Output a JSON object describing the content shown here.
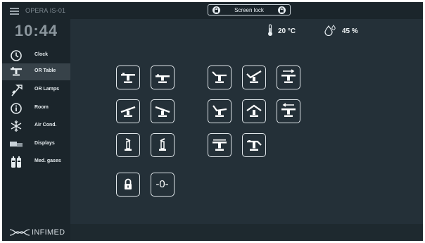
{
  "header": {
    "device_name": "OPERA IS-01",
    "time": "10:44"
  },
  "topbar": {
    "lock_label": "Screen lock"
  },
  "status": {
    "temperature": "20 °C",
    "humidity": "45 %"
  },
  "sidebar": {
    "items": [
      {
        "label": "Clock",
        "icon": "clock-icon",
        "active": false
      },
      {
        "label": "OR Table",
        "icon": "or-table-icon",
        "active": true
      },
      {
        "label": "OR Lamps",
        "icon": "or-lamp-icon",
        "active": false
      },
      {
        "label": "Room",
        "icon": "info-icon",
        "active": false
      },
      {
        "label": "Air Cond.",
        "icon": "snowflake-icon",
        "active": false
      },
      {
        "label": "Displays",
        "icon": "displays-icon",
        "active": false
      },
      {
        "label": "Med. gases",
        "icon": "gas-cylinders-icon",
        "active": false
      }
    ]
  },
  "logo": {
    "text": "INFIMED"
  },
  "controls": {
    "zero_label": "-0-",
    "buttons": [
      "table-flat-icon",
      "table-flat-low-icon",
      "table-tilt-head-up-icon",
      "table-tilt-check-icon",
      "table-move-right-icon",
      "table-trend-icon",
      "table-reverse-trend-icon",
      "table-back-up-icon",
      "table-flex-icon",
      "table-move-left-icon",
      "column-up-icon",
      "column-down-icon",
      "table-lateral-tilt-icon",
      "table-leg-down-icon",
      "lock-icon",
      "zero-position-icon"
    ]
  },
  "colors": {
    "background": "#243038",
    "sidebar": "#1b252b",
    "active": "#374249",
    "border": "#dfe5e9"
  }
}
